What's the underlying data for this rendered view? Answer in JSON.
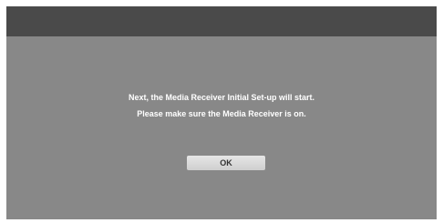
{
  "dialog": {
    "message_line_1": "Next, the Media Receiver Initial Set-up will start.",
    "message_line_2": "Please make sure the Media Receiver is on.",
    "ok_label": "OK"
  },
  "colors": {
    "screen_background": "#888888",
    "header_bar": "#4a4a4a",
    "message_text": "#ffffff",
    "button_face": "#dcdcdc",
    "button_text": "#333333"
  }
}
